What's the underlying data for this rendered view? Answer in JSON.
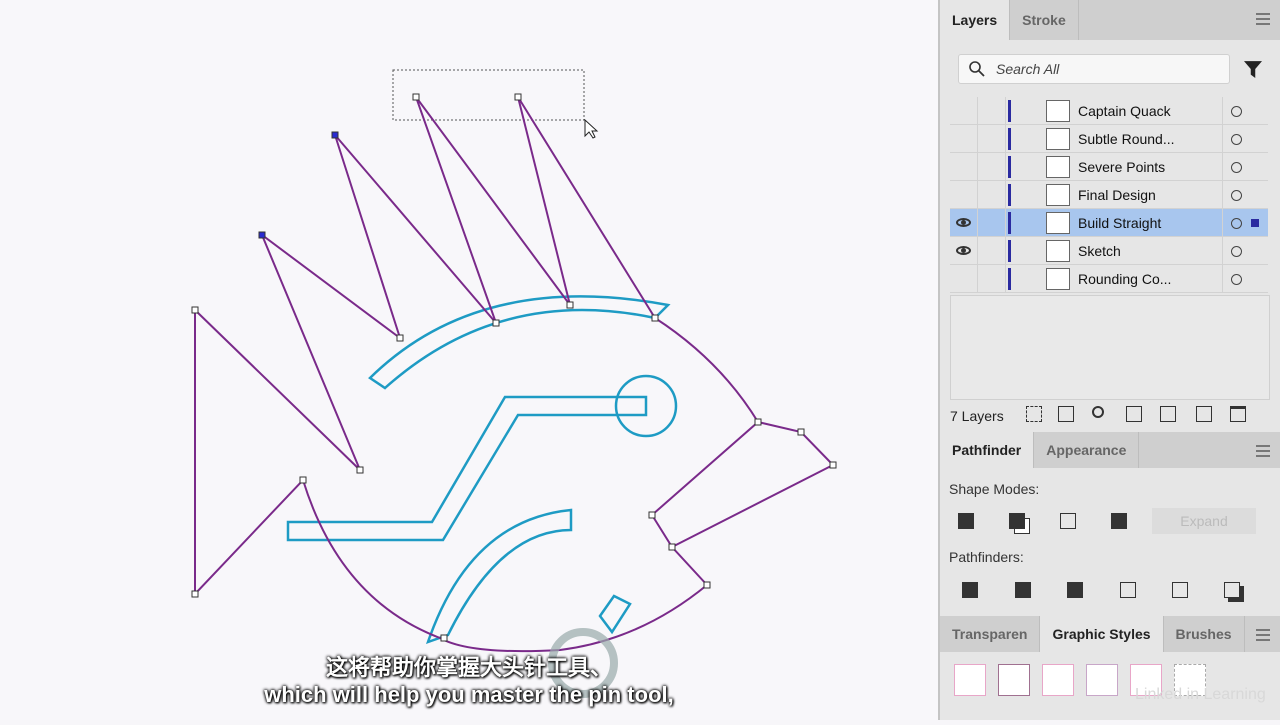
{
  "layers_panel": {
    "tabs": [
      "Layers",
      "Stroke"
    ],
    "search_placeholder": "Search All",
    "count": "7 Layers",
    "layers": [
      {
        "name": "Captain Quack",
        "visible": false,
        "selected": false
      },
      {
        "name": "Subtle Round...",
        "visible": false,
        "selected": false
      },
      {
        "name": "Severe Points",
        "visible": false,
        "selected": false
      },
      {
        "name": "Final Design",
        "visible": false,
        "selected": false
      },
      {
        "name": "Build Straight",
        "visible": true,
        "selected": true
      },
      {
        "name": "Sketch",
        "visible": true,
        "selected": false
      },
      {
        "name": "Rounding Co...",
        "visible": false,
        "selected": false
      }
    ]
  },
  "pathfinder_panel": {
    "tabs": [
      "Pathfinder",
      "Appearance"
    ],
    "shape_modes_label": "Shape Modes:",
    "expand_label": "Expand",
    "pathfinders_label": "Pathfinders:"
  },
  "styles_panel": {
    "tabs": [
      "Transparen",
      "Graphic Styles",
      "Brushes"
    ]
  },
  "subtitles": {
    "zh": "这将帮助你掌握大头针工具、",
    "en": "which will help you master the pin tool,"
  },
  "watermark": {
    "linkedin": "Linked in Learning",
    "rrcg": "RRCG 人人素材"
  },
  "colors": {
    "selection": "#a8c6ee",
    "path_blue": "#1e9bc4",
    "path_purple": "#7a2a8a",
    "accent": "#2a2aa0"
  }
}
